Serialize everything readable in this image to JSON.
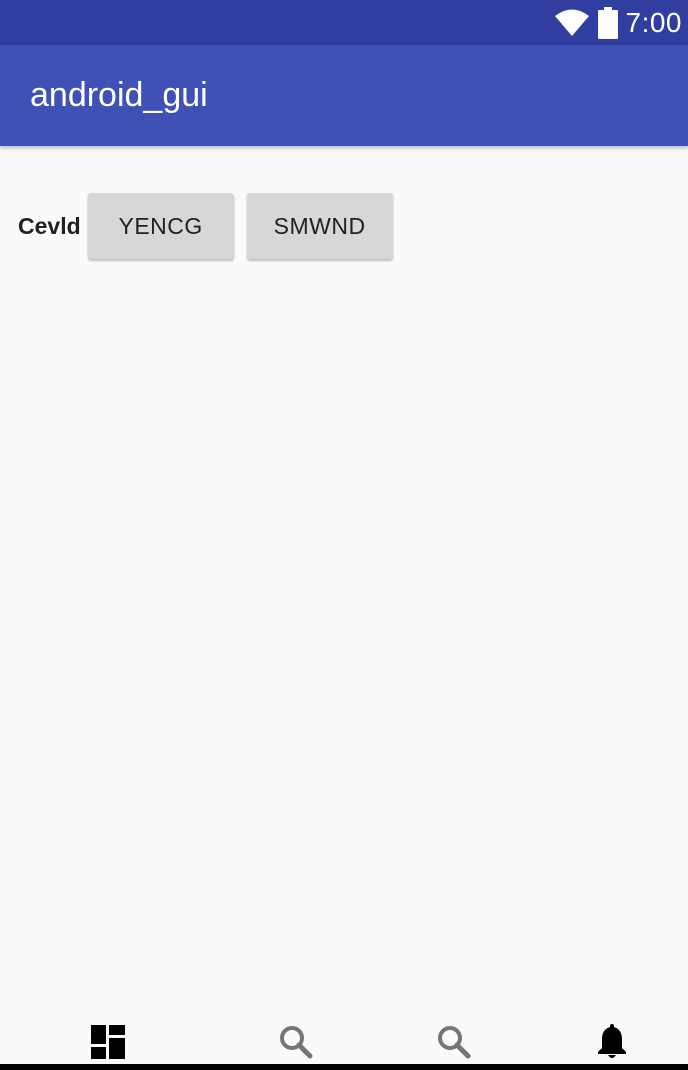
{
  "status_bar": {
    "time": "7:00",
    "icons": [
      "wifi-icon",
      "battery-icon"
    ],
    "color": "#303f9f"
  },
  "app_bar": {
    "title": "android_gui",
    "color": "#3f51b5"
  },
  "content": {
    "label": "Cevld",
    "buttons": [
      "YENCG",
      "SMWND"
    ]
  },
  "bottom_nav": {
    "items": [
      {
        "icon": "dashboard-icon",
        "active": true
      },
      {
        "icon": "search-icon",
        "active": false
      },
      {
        "icon": "search-icon",
        "active": false
      },
      {
        "icon": "notifications-icon",
        "active": true
      }
    ],
    "active_color": "#000000",
    "inactive_color": "#757575"
  }
}
